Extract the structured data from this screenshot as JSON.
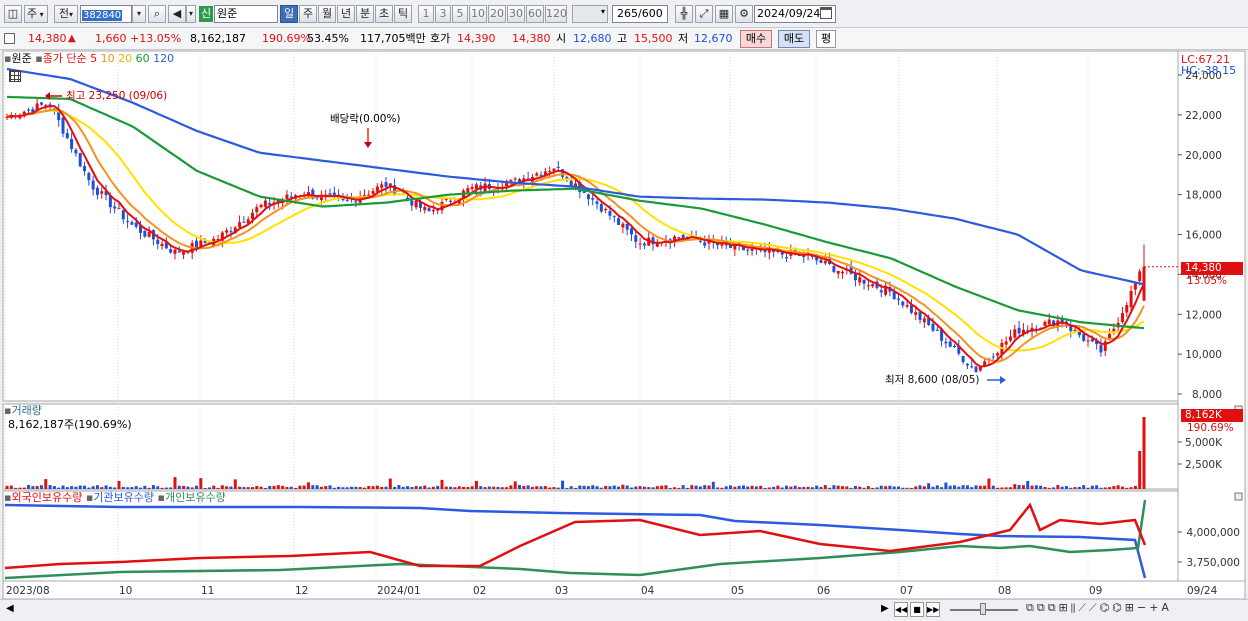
{
  "toolbar": {
    "type_label": "주",
    "prev_label": "전",
    "code": "382840",
    "badge": "신",
    "name": "원준",
    "periods": [
      "일",
      "주",
      "월",
      "년",
      "분",
      "초",
      "틱"
    ],
    "minutes": [
      "1",
      "3",
      "5",
      "10",
      "20",
      "30",
      "60",
      "120"
    ],
    "count": "265",
    "count_total": "/600",
    "date": "2024/09/24"
  },
  "quote": {
    "price": "14,380",
    "arrow": "▲",
    "change": "1,660",
    "pct": "+13.05%",
    "volume": "8,162,187",
    "vol_ratio": "190.69%",
    "turnover": "53.45%",
    "amount": "117,705백만",
    "ask_label": "호가",
    "ask1": "14,390",
    "ask2": "14,380",
    "open_label": "시",
    "open": "12,680",
    "high_label": "고",
    "high": "15,500",
    "low_label": "저",
    "low": "12,670",
    "buy_label": "매수",
    "sell_label": "매도",
    "eval_label": "평"
  },
  "legend": {
    "name": "원준",
    "ma_label": "종가 단순 5",
    "ma10": "10",
    "ma20": "20",
    "ma60": "60",
    "ma120": "120",
    "lc": "LC:67.21",
    "hc": "HC:-38.15"
  },
  "colors": {
    "up": "#e01010",
    "down": "#1f4fd8",
    "ma5": "#e01010",
    "ma10": "#f59220",
    "ma20": "#ffe100",
    "ma60": "#1a9a3a",
    "ma120": "#2c5be0",
    "foreign": "#e01010",
    "institution": "#2c5be0",
    "individual": "#2f8f5a"
  },
  "annotations": {
    "high": "최고 23,250 (09/06)",
    "low": "최저 8,600 (08/05)",
    "dividend": "배당락(0.00%)",
    "price_tag": "14,380",
    "price_pct": "13.05%"
  },
  "volume_panel": {
    "title": "거래량",
    "value": "8,162,187주(190.69%)",
    "tag": "8,162K",
    "tag_pct": "190.69%"
  },
  "holdings_panel": {
    "foreign": "외국인보유수량",
    "institution": "기관보유수량",
    "individual": "개인보유수량"
  },
  "chart_data": {
    "type": "candlestick",
    "price_axis": {
      "ticks": [
        "24,000",
        "22,000",
        "20,000",
        "18,000",
        "16,000",
        "14,000",
        "12,000",
        "10,000",
        "8,000"
      ],
      "ylim": [
        8000,
        24000
      ]
    },
    "volume_axis": {
      "ticks": [
        "5,000K",
        "2,500K"
      ]
    },
    "holdings_axis": {
      "ticks": [
        "4,000,000",
        "3,750,000"
      ]
    },
    "x_ticks": [
      "2023/08",
      "10",
      "11",
      "12",
      "2024/01",
      "02",
      "03",
      "04",
      "05",
      "06",
      "07",
      "08",
      "09",
      "09/24"
    ],
    "close": [
      {
        "t": "2023/08",
        "v": 21900
      },
      {
        "t": "2023/09 mid",
        "v": 22600
      },
      {
        "t": "2023/09 end",
        "v": 18500
      },
      {
        "t": "2023/10 mid",
        "v": 16400
      },
      {
        "t": "2023/10 end",
        "v": 15100
      },
      {
        "t": "2023/11 mid",
        "v": 15800
      },
      {
        "t": "2023/11 end",
        "v": 17400
      },
      {
        "t": "2023/12 mid",
        "v": 18100
      },
      {
        "t": "2023/12 end",
        "v": 17600
      },
      {
        "t": "2024/01 mid",
        "v": 18500
      },
      {
        "t": "2024/01 end",
        "v": 17100
      },
      {
        "t": "2024/02 mid",
        "v": 18300
      },
      {
        "t": "2024/02 end",
        "v": 18600
      },
      {
        "t": "2024/03 mid",
        "v": 19400
      },
      {
        "t": "2024/03 end",
        "v": 17600
      },
      {
        "t": "2024/04 mid",
        "v": 15600
      },
      {
        "t": "2024/04 end",
        "v": 15900
      },
      {
        "t": "2024/05 mid",
        "v": 15400
      },
      {
        "t": "2024/05 end",
        "v": 15100
      },
      {
        "t": "2024/06 mid",
        "v": 14900
      },
      {
        "t": "2024/06 end",
        "v": 14000
      },
      {
        "t": "2024/07 mid",
        "v": 13100
      },
      {
        "t": "2024/07 end",
        "v": 11200
      },
      {
        "t": "2024/08 start",
        "v": 9200
      },
      {
        "t": "2024/08 mid",
        "v": 11200
      },
      {
        "t": "2024/08 end",
        "v": 11700
      },
      {
        "t": "2024/09 mid",
        "v": 10100
      },
      {
        "t": "2024/09/24",
        "v": 14380
      }
    ],
    "ma120": [
      24300,
      23800,
      22600,
      21200,
      20100,
      19700,
      19300,
      18900,
      18600,
      18400,
      17900,
      17800,
      17750,
      17600,
      17300,
      16800,
      16000,
      14200,
      13500
    ],
    "ma60": [
      22900,
      22800,
      21400,
      19200,
      17900,
      17400,
      17600,
      18000,
      18200,
      18300,
      17700,
      17300,
      16500,
      15600,
      14800,
      13400,
      12200,
      11600,
      11300
    ],
    "volume_latest_k": 8162,
    "holdings": {
      "foreign_range": [
        3700000,
        4150000
      ],
      "institution_range": [
        3650000,
        4100000
      ],
      "individual_range": [
        3700000,
        4100000
      ]
    }
  }
}
